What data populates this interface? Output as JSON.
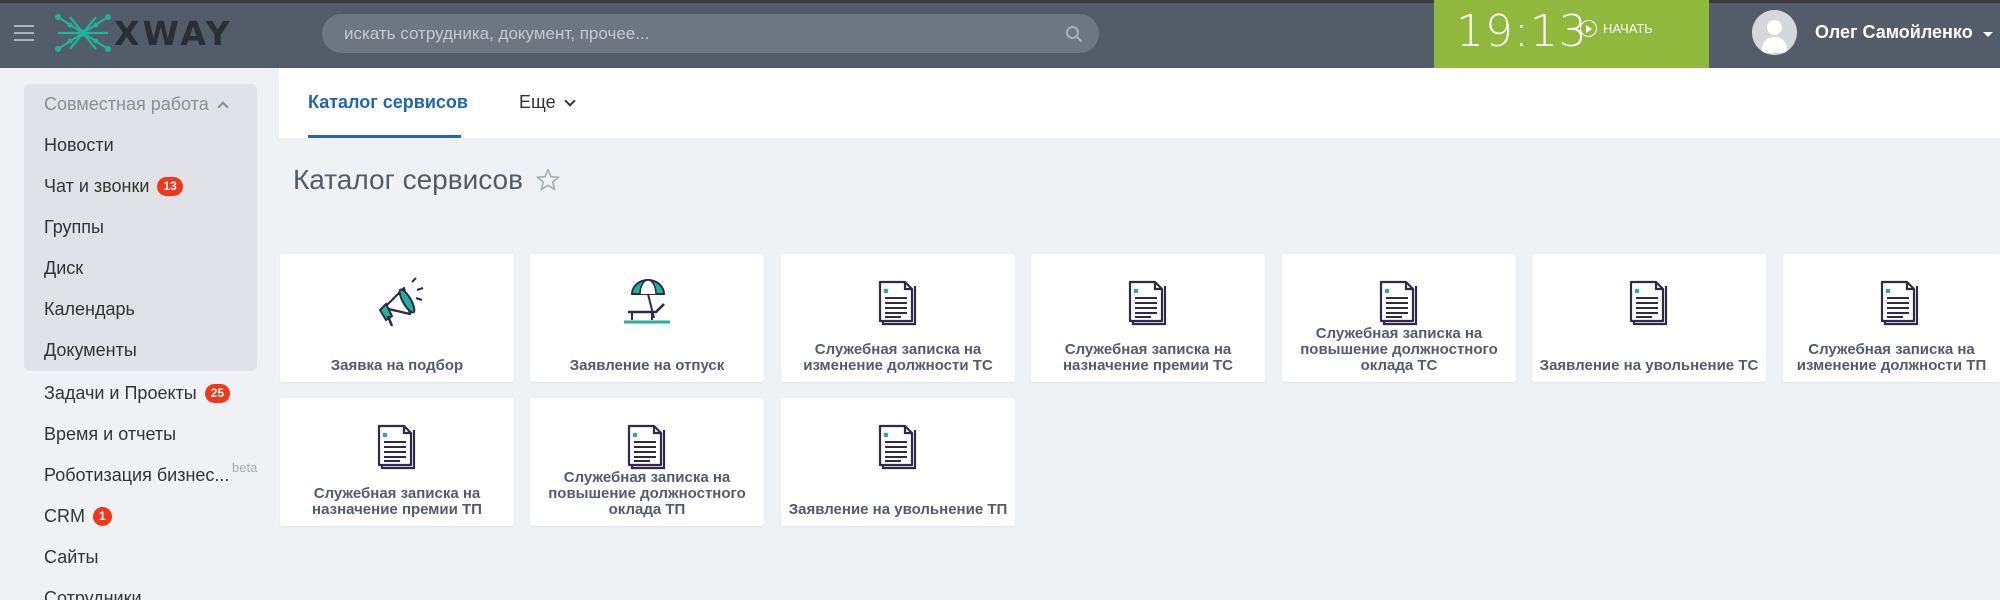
{
  "header": {
    "logo_text": "XWAY",
    "search_placeholder": "искать сотрудника, документ, прочее...",
    "clock": "19:13",
    "start_label": "НАЧАТЬ",
    "user_name": "Олег Самойленко",
    "colors": {
      "header_bg": "#535c69",
      "clock_bg": "#8fb83d",
      "logo_accent": "#1fb39a"
    }
  },
  "sidebar": {
    "group_title": "Совместная работа",
    "items": [
      {
        "label": "Новости"
      },
      {
        "label": "Чат и звонки",
        "badge": "13"
      },
      {
        "label": "Группы"
      },
      {
        "label": "Диск"
      },
      {
        "label": "Календарь"
      },
      {
        "label": "Документы"
      },
      {
        "label": "Задачи и Проекты",
        "badge": "25"
      },
      {
        "label": "Время и отчеты"
      },
      {
        "label": "Роботизация бизнес..."
      },
      {
        "label": "CRM",
        "badge": "1"
      },
      {
        "label": "Сайты"
      },
      {
        "label": "Сотрудники"
      }
    ],
    "beta_label": "beta"
  },
  "tabs": {
    "active": "Каталог сервисов",
    "more": "Еще"
  },
  "page_title": "Каталог сервисов",
  "cards": [
    {
      "title": "Заявка на подбор",
      "icon": "megaphone-icon"
    },
    {
      "title": "Заявление на отпуск",
      "icon": "beach-chair-icon"
    },
    {
      "title": "Служебная записка на изменение должности ТС",
      "icon": "document-icon"
    },
    {
      "title": "Служебная записка на назначение премии ТС",
      "icon": "document-icon"
    },
    {
      "title": "Служебная записка на повышение должностного оклада ТС",
      "icon": "document-icon"
    },
    {
      "title": "Заявление на увольнение ТС",
      "icon": "document-icon"
    },
    {
      "title": "Служебная записка на изменение должности ТП",
      "icon": "document-icon"
    },
    {
      "title": "Служебная записка на назначение премии ТП",
      "icon": "document-icon"
    },
    {
      "title": "Служебная записка на повышение должностного оклада ТП",
      "icon": "document-icon"
    },
    {
      "title": "Заявление на увольнение ТП",
      "icon": "document-icon"
    }
  ]
}
